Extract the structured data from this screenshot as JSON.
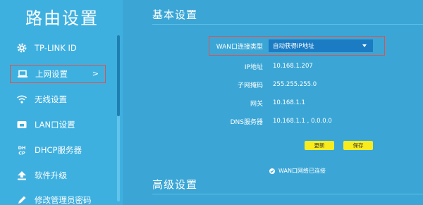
{
  "sidebar": {
    "title": "路由设置",
    "items": [
      {
        "label": "TP-LINK ID",
        "icon": "gear-icon"
      },
      {
        "label": "上网设置",
        "icon": "laptop-icon",
        "arrow": ">"
      },
      {
        "label": "无线设置",
        "icon": "wifi-icon"
      },
      {
        "label": "LAN口设置",
        "icon": "lan-icon"
      },
      {
        "label": "DHCP服务器",
        "icon": "dhcp-icon"
      },
      {
        "label": "软件升级",
        "icon": "upgrade-icon"
      },
      {
        "label": "修改管理员密码",
        "icon": "pencil-icon"
      }
    ]
  },
  "main": {
    "basic_title": "基本设置",
    "advanced_title": "高级设置",
    "wan": {
      "label": "WAN口连接类型",
      "value": "自动获得IP地址"
    },
    "fields": [
      {
        "label": "IP地址",
        "value": "10.168.1.207"
      },
      {
        "label": "子网掩码",
        "value": "255.255.255.0"
      },
      {
        "label": "网关",
        "value": "10.168.1.1"
      },
      {
        "label": "DNS服务器",
        "value": "10.168.1.1 , 0.0.0.0"
      }
    ],
    "buttons": {
      "refresh": "更新",
      "save": "保存"
    },
    "status": "WAN口网络已连接"
  },
  "colors": {
    "background": "#3ba6d6",
    "sidebar": "#3eb0e0",
    "highlight_border": "#e0504a",
    "button": "#f8ec1e",
    "select": "#1b7cc4"
  }
}
